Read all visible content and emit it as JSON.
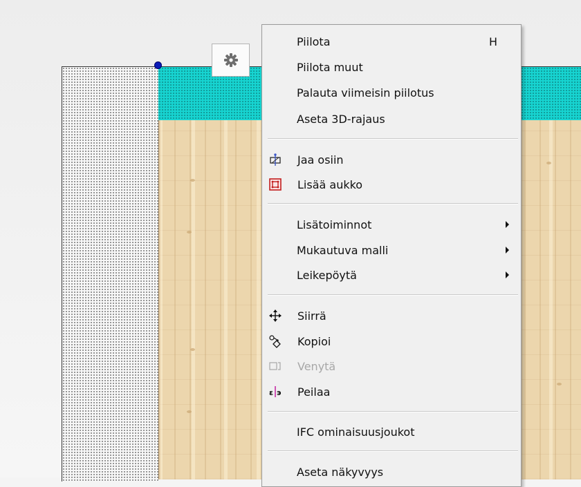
{
  "context_menu": {
    "items": [
      {
        "label": "Piilota",
        "shortcut": "H"
      },
      {
        "label": "Piilota muut"
      },
      {
        "label": "Palauta viimeisin piilotus"
      },
      {
        "label": "Aseta 3D-rajaus"
      },
      {
        "label": "Jaa osiin",
        "icon": "split-icon"
      },
      {
        "label": "Lisää aukko",
        "icon": "add-opening-icon"
      },
      {
        "label": "Lisätoiminnot",
        "submenu": true
      },
      {
        "label": "Mukautuva malli",
        "submenu": true
      },
      {
        "label": "Leikepöytä",
        "submenu": true
      },
      {
        "label": "Siirrä",
        "icon": "move-icon"
      },
      {
        "label": "Kopioi",
        "icon": "copy-icon"
      },
      {
        "label": "Venytä",
        "icon": "stretch-icon",
        "disabled": true
      },
      {
        "label": "Peilaa",
        "icon": "mirror-icon"
      },
      {
        "label": "IFC ominaisuusjoukot"
      },
      {
        "label": "Aseta näkyvyys"
      }
    ]
  },
  "colors": {
    "cyan_strip": "#17d4d1",
    "handle": "#0b1bb8",
    "menu_bg": "#f0f0f0",
    "disabled_text": "#a7a7a7"
  },
  "toolbar": {
    "gear_icon": "gear-icon"
  }
}
